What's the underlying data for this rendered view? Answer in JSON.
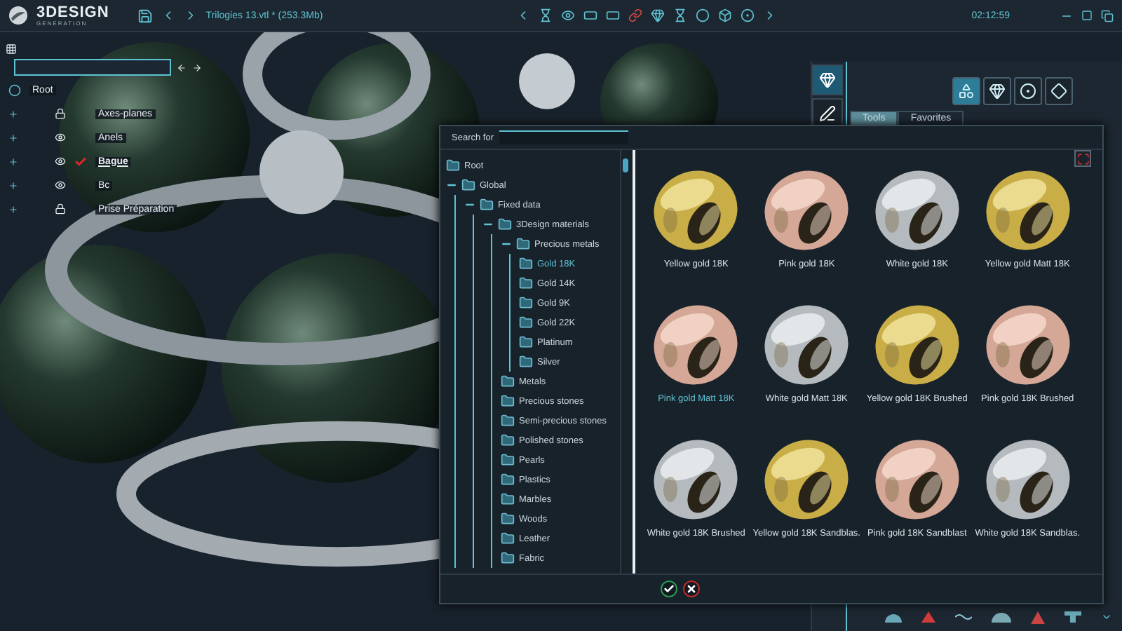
{
  "app": {
    "logo": "3DESIGN",
    "logo_subtitle": "GENERATION",
    "file": "Trilogies 13.vtl *",
    "size": "(253.3Mb)",
    "time": "02:12:59"
  },
  "scene_tree": {
    "root": "Root",
    "items": [
      {
        "label": "Axes-planes",
        "kind": "lock",
        "selected": false
      },
      {
        "label": "Anels",
        "kind": "eye",
        "selected": false
      },
      {
        "label": "Bague",
        "kind": "eye",
        "selected": true
      },
      {
        "label": "Bc",
        "kind": "eye",
        "selected": false
      },
      {
        "label": "Prise Préparation",
        "kind": "lock",
        "selected": false
      }
    ]
  },
  "right_panel": {
    "modes": [
      {
        "kind": "ring",
        "selected": true
      },
      {
        "kind": "pencil",
        "selected": false
      }
    ],
    "tools": [
      {
        "kind": "shapes",
        "selected": true
      },
      {
        "kind": "gem",
        "selected": false
      },
      {
        "kind": "circles",
        "selected": false
      },
      {
        "kind": "diamond",
        "selected": false
      }
    ],
    "tabs": [
      {
        "label": "Tools",
        "selected": true
      },
      {
        "label": "Favorites",
        "selected": false
      }
    ]
  },
  "material_dialog": {
    "search_label": "Search for",
    "tree": [
      {
        "label": "Root",
        "selected": false
      },
      {
        "label": "Global",
        "selected": false,
        "expanded": true,
        "children": [
          {
            "label": "Fixed data",
            "selected": false,
            "expanded": true,
            "children": [
              {
                "label": "3Design materials",
                "selected": false,
                "expanded": true,
                "children": [
                  {
                    "label": "Precious metals",
                    "selected": false,
                    "expanded": true,
                    "children": [
                      {
                        "label": "Gold 18K",
                        "selected": true
                      },
                      {
                        "label": "Gold 14K",
                        "selected": false
                      },
                      {
                        "label": "Gold 9K",
                        "selected": false
                      },
                      {
                        "label": "Gold 22K",
                        "selected": false
                      },
                      {
                        "label": "Platinum",
                        "selected": false
                      },
                      {
                        "label": "Silver",
                        "selected": false
                      }
                    ]
                  },
                  {
                    "label": "Metals",
                    "selected": false
                  },
                  {
                    "label": "Precious stones",
                    "selected": false
                  },
                  {
                    "label": "Semi-precious stones",
                    "selected": false
                  },
                  {
                    "label": "Polished stones",
                    "selected": false
                  },
                  {
                    "label": "Pearls",
                    "selected": false
                  },
                  {
                    "label": "Plastics",
                    "selected": false
                  },
                  {
                    "label": "Marbles",
                    "selected": false
                  },
                  {
                    "label": "Woods",
                    "selected": false
                  },
                  {
                    "label": "Leather",
                    "selected": false
                  },
                  {
                    "label": "Fabric",
                    "selected": false
                  }
                ]
              }
            ]
          }
        ]
      }
    ],
    "materials": [
      {
        "label": "Yellow gold 18K",
        "selected": false
      },
      {
        "label": "Pink gold 18K",
        "selected": false
      },
      {
        "label": "White gold 18K",
        "selected": false
      },
      {
        "label": "Yellow gold Matt 18K",
        "selected": false
      },
      {
        "label": "Pink gold Matt 18K",
        "selected": true
      },
      {
        "label": "White gold Matt 18K",
        "selected": false
      },
      {
        "label": "Yellow gold 18K Brushed",
        "selected": false
      },
      {
        "label": "Pink gold 18K Brushed",
        "selected": false
      },
      {
        "label": "White gold 18K Brushed",
        "selected": false
      },
      {
        "label": "Yellow gold 18K Sandblas.",
        "selected": false
      },
      {
        "label": "Pink gold 18K Sandblast",
        "selected": false
      },
      {
        "label": "White gold 18K Sandblas.",
        "selected": false
      }
    ]
  }
}
